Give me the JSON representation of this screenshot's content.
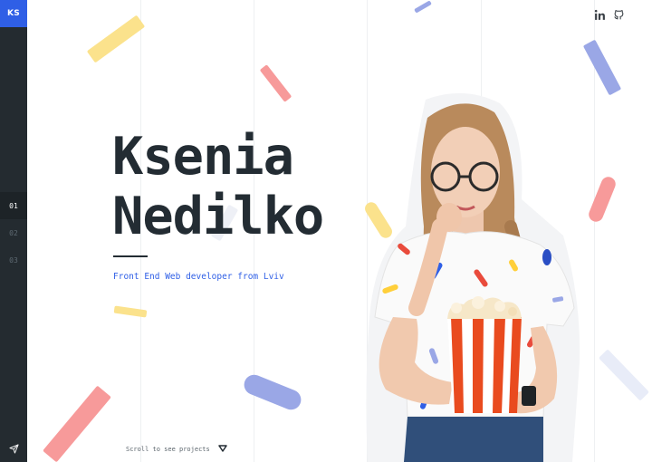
{
  "sidebar": {
    "logo": "KS",
    "nav": [
      "01",
      "02",
      "03"
    ],
    "active_index": 0,
    "send_icon": "send-icon"
  },
  "social": {
    "icons": [
      "linkedin-icon",
      "github-icon"
    ]
  },
  "hero": {
    "first_name": "Ksenia",
    "last_name": "Nedilko",
    "tagline": "Front End Web developer from Lviv"
  },
  "scroll": {
    "label": "Scroll to see projects",
    "icon": "triangle-down-icon"
  },
  "colors": {
    "accent": "#2f5fe6",
    "sidebar": "#242b30",
    "text": "#232c33",
    "yellow": "#fbe28c",
    "pink": "#f79a9a",
    "blue": "#9aa7e6"
  }
}
